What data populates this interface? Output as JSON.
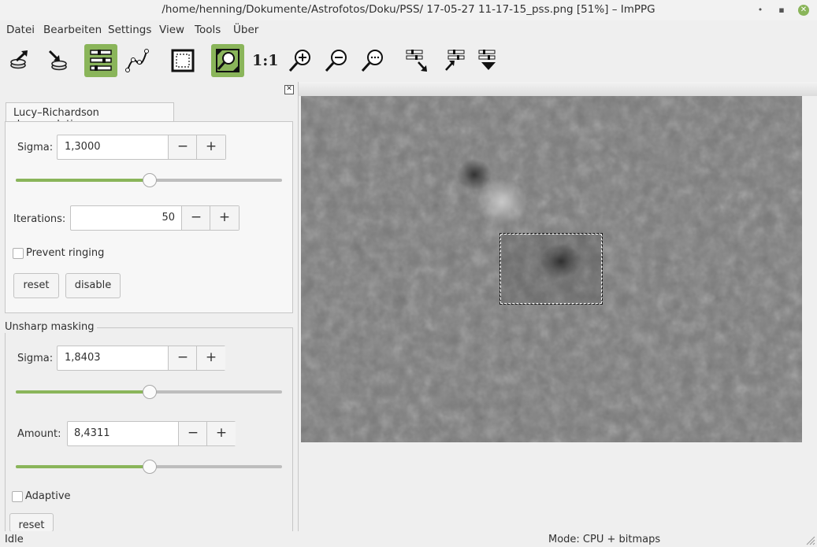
{
  "window": {
    "title": "/home/henning/Dokumente/Astrofotos/Doku/PSS/ 17-05-27 11-17-15_pss.png [51%] – ImPPG",
    "minimize_glyph": "•",
    "maximize_glyph": "▪",
    "close_glyph": "✕"
  },
  "menu": [
    "Datei",
    "Bearbeiten",
    "Settings",
    "View",
    "Tools",
    "Über"
  ],
  "toolbar": {
    "icons": [
      "open-image-icon",
      "save-image-icon",
      "processing-settings-icon",
      "tone-curve-icon",
      "select-roi-icon",
      "fit-window-icon",
      "zoom-in-icon",
      "zoom-out-icon",
      "zoom-custom-icon",
      "align-images-icon",
      "batch-process-icon",
      "settings-menu-icon"
    ],
    "zoom_1to1_label": "1:1"
  },
  "panel": {
    "close_glyph": "✕",
    "tab_label": "Lucy–Richardson deconvolution",
    "lr": {
      "sigma_label": "Sigma:",
      "sigma_value": "1,3000",
      "sigma_slider": 0.5,
      "iterations_label": "Iterations:",
      "iterations_value": "50",
      "prevent_ringing_label": "Prevent ringing",
      "prevent_ringing_checked": false,
      "reset_label": "reset",
      "disable_label": "disable"
    },
    "unsharp": {
      "group_title": "Unsharp masking",
      "sigma_label": "Sigma:",
      "sigma_value": "1,8403",
      "sigma_slider": 0.5,
      "amount_label": "Amount:",
      "amount_value": "8,4311",
      "amount_slider": 0.5,
      "adaptive_label": "Adaptive",
      "adaptive_checked": false,
      "reset_label": "reset"
    },
    "minus_glyph": "−",
    "plus_glyph": "+"
  },
  "status": {
    "left": "Idle",
    "mode": "Mode: CPU + bitmaps"
  },
  "colors": {
    "accent": "#8ab55a",
    "image_gray": "#7a7a7a"
  }
}
